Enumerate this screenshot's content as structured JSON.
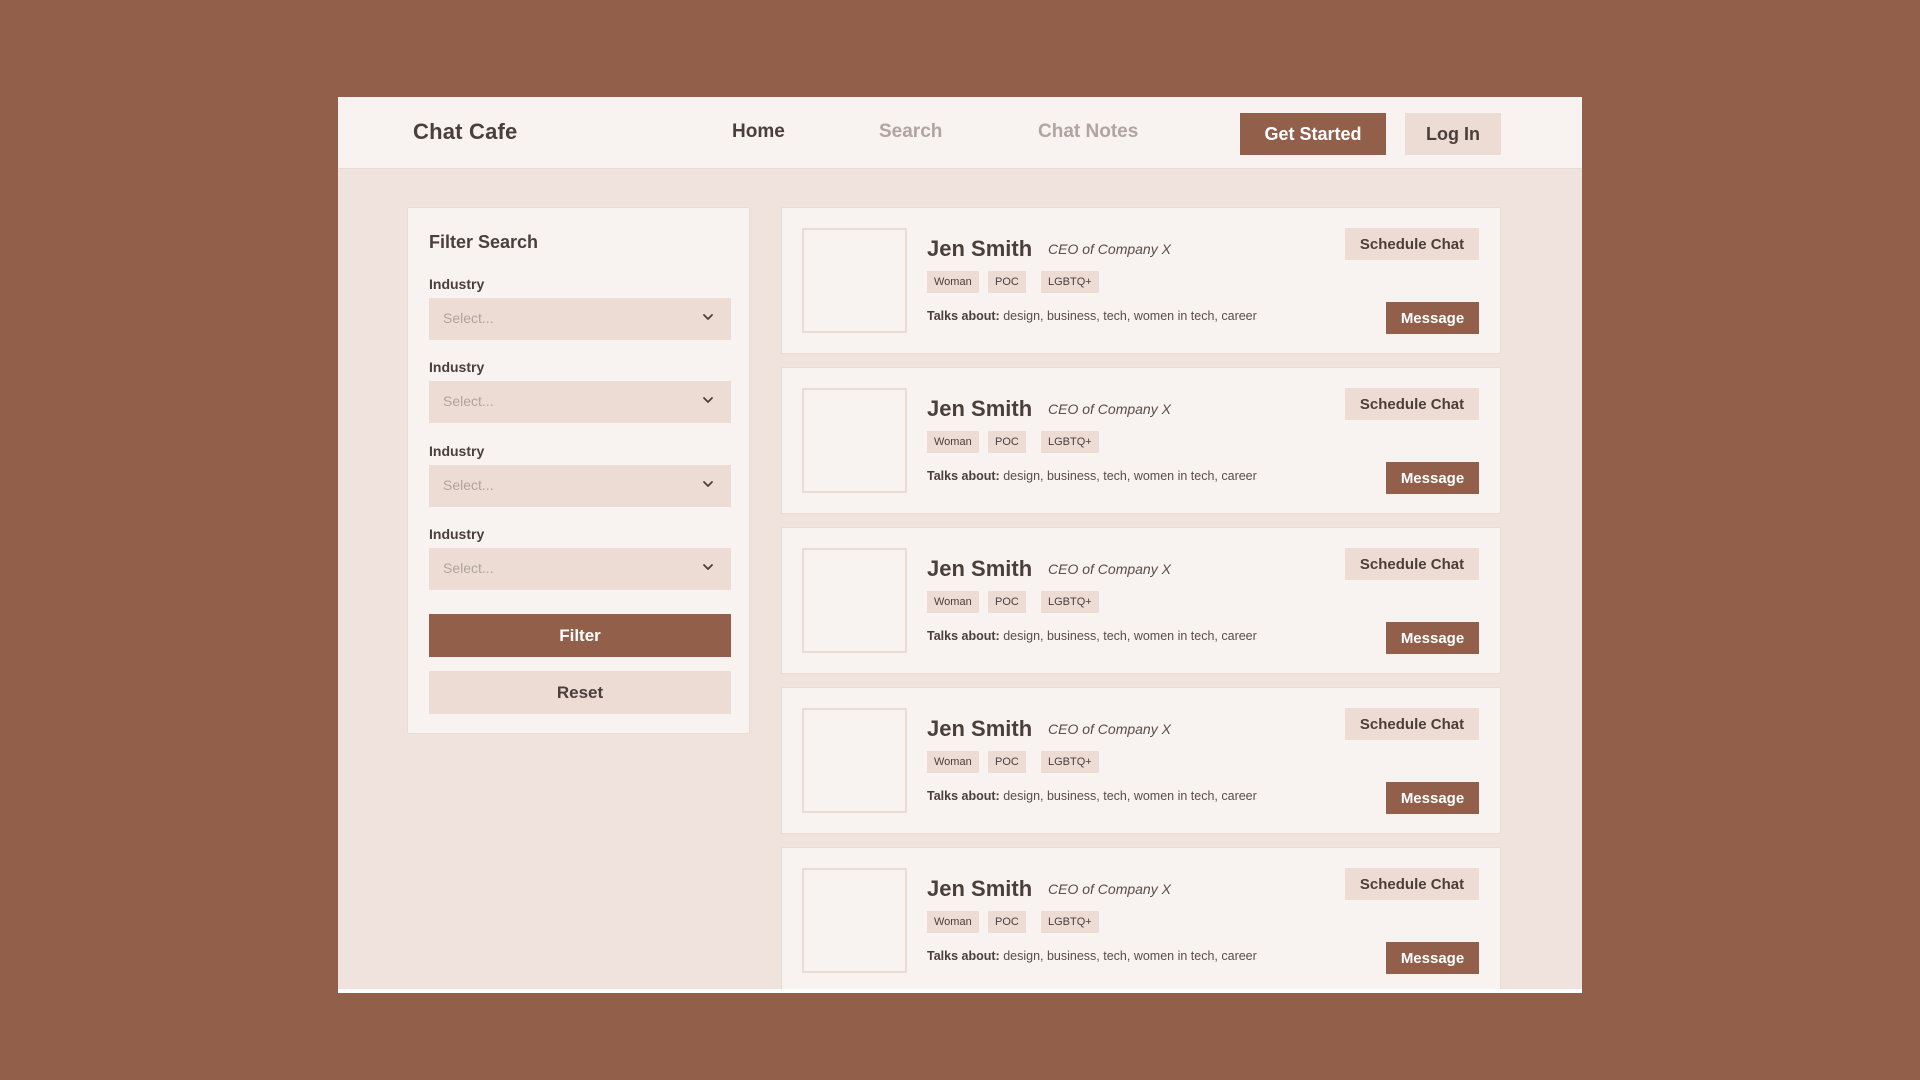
{
  "header": {
    "brand": "Chat Cafe",
    "nav": [
      "Home",
      "Search",
      "Chat Notes"
    ],
    "active_nav": "Home",
    "get_started_label": "Get Started",
    "login_label": "Log In"
  },
  "filter": {
    "title": "Filter Search",
    "fields": [
      {
        "label": "Industry",
        "placeholder": "Select..."
      },
      {
        "label": "Industry",
        "placeholder": "Select..."
      },
      {
        "label": "Industry",
        "placeholder": "Select..."
      },
      {
        "label": "Industry",
        "placeholder": "Select..."
      }
    ],
    "filter_label": "Filter",
    "reset_label": "Reset"
  },
  "profiles": [
    {
      "name": "Jen Smith",
      "title": "CEO of Company X",
      "tags": [
        "Woman",
        "POC",
        "LGBTQ+"
      ],
      "talks_label": "Talks about:",
      "talks": "design, business, tech, women in tech, career",
      "schedule_label": "Schedule Chat",
      "message_label": "Message"
    },
    {
      "name": "Jen Smith",
      "title": "CEO of Company X",
      "tags": [
        "Woman",
        "POC",
        "LGBTQ+"
      ],
      "talks_label": "Talks about:",
      "talks": "design, business, tech, women in tech, career",
      "schedule_label": "Schedule Chat",
      "message_label": "Message"
    },
    {
      "name": "Jen Smith",
      "title": "CEO of Company X",
      "tags": [
        "Woman",
        "POC",
        "LGBTQ+"
      ],
      "talks_label": "Talks about:",
      "talks": "design, business, tech, women in tech, career",
      "schedule_label": "Schedule Chat",
      "message_label": "Message"
    },
    {
      "name": "Jen Smith",
      "title": "CEO of Company X",
      "tags": [
        "Woman",
        "POC",
        "LGBTQ+"
      ],
      "talks_label": "Talks about:",
      "talks": "design, business, tech, women in tech, career",
      "schedule_label": "Schedule Chat",
      "message_label": "Message"
    },
    {
      "name": "Jen Smith",
      "title": "CEO of Company X",
      "tags": [
        "Woman",
        "POC",
        "LGBTQ+"
      ],
      "talks_label": "Talks about:",
      "talks": "design, business, tech, women in tech, career",
      "schedule_label": "Schedule Chat",
      "message_label": "Message"
    }
  ],
  "colors": {
    "background": "#915f4a",
    "accent": "#915f4a",
    "panel": "#f8f2f0",
    "page": "#f0e2dc",
    "secondary_button": "#ecdcd4"
  }
}
